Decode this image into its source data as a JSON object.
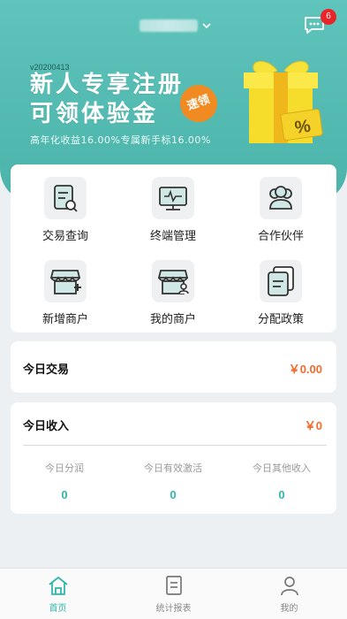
{
  "header": {
    "notification_count": "6"
  },
  "banner": {
    "version": "v20200413",
    "title_line1": "新人专享注册",
    "title_line2": "可领体验金",
    "subtitle": "高年化收益16.00%专属新手标16.00%",
    "claim_label": "速领",
    "gift_symbol": "%"
  },
  "menu": {
    "items": [
      {
        "label": "交易查询",
        "icon": "transaction-search-icon"
      },
      {
        "label": "终端管理",
        "icon": "terminal-icon"
      },
      {
        "label": "合作伙伴",
        "icon": "partners-icon"
      },
      {
        "label": "新增商户",
        "icon": "add-merchant-icon"
      },
      {
        "label": "我的商户",
        "icon": "my-merchant-icon"
      },
      {
        "label": "分配政策",
        "icon": "policy-icon"
      }
    ]
  },
  "today_trade": {
    "title": "今日交易",
    "amount": "￥0.00"
  },
  "today_income": {
    "title": "今日收入",
    "amount": "￥0",
    "stats": [
      {
        "label": "今日分润",
        "value": "0"
      },
      {
        "label": "今日有效激活",
        "value": "0"
      },
      {
        "label": "今日其他收入",
        "value": "0"
      }
    ]
  },
  "tabs": [
    {
      "label": "首页",
      "icon": "home-icon",
      "active": true
    },
    {
      "label": "统计报表",
      "icon": "report-icon",
      "active": false
    },
    {
      "label": "我的",
      "icon": "user-icon",
      "active": false
    }
  ],
  "colors": {
    "primary": "#4bb3aa",
    "accent": "#f06a2a",
    "badge": "#e8262a"
  }
}
